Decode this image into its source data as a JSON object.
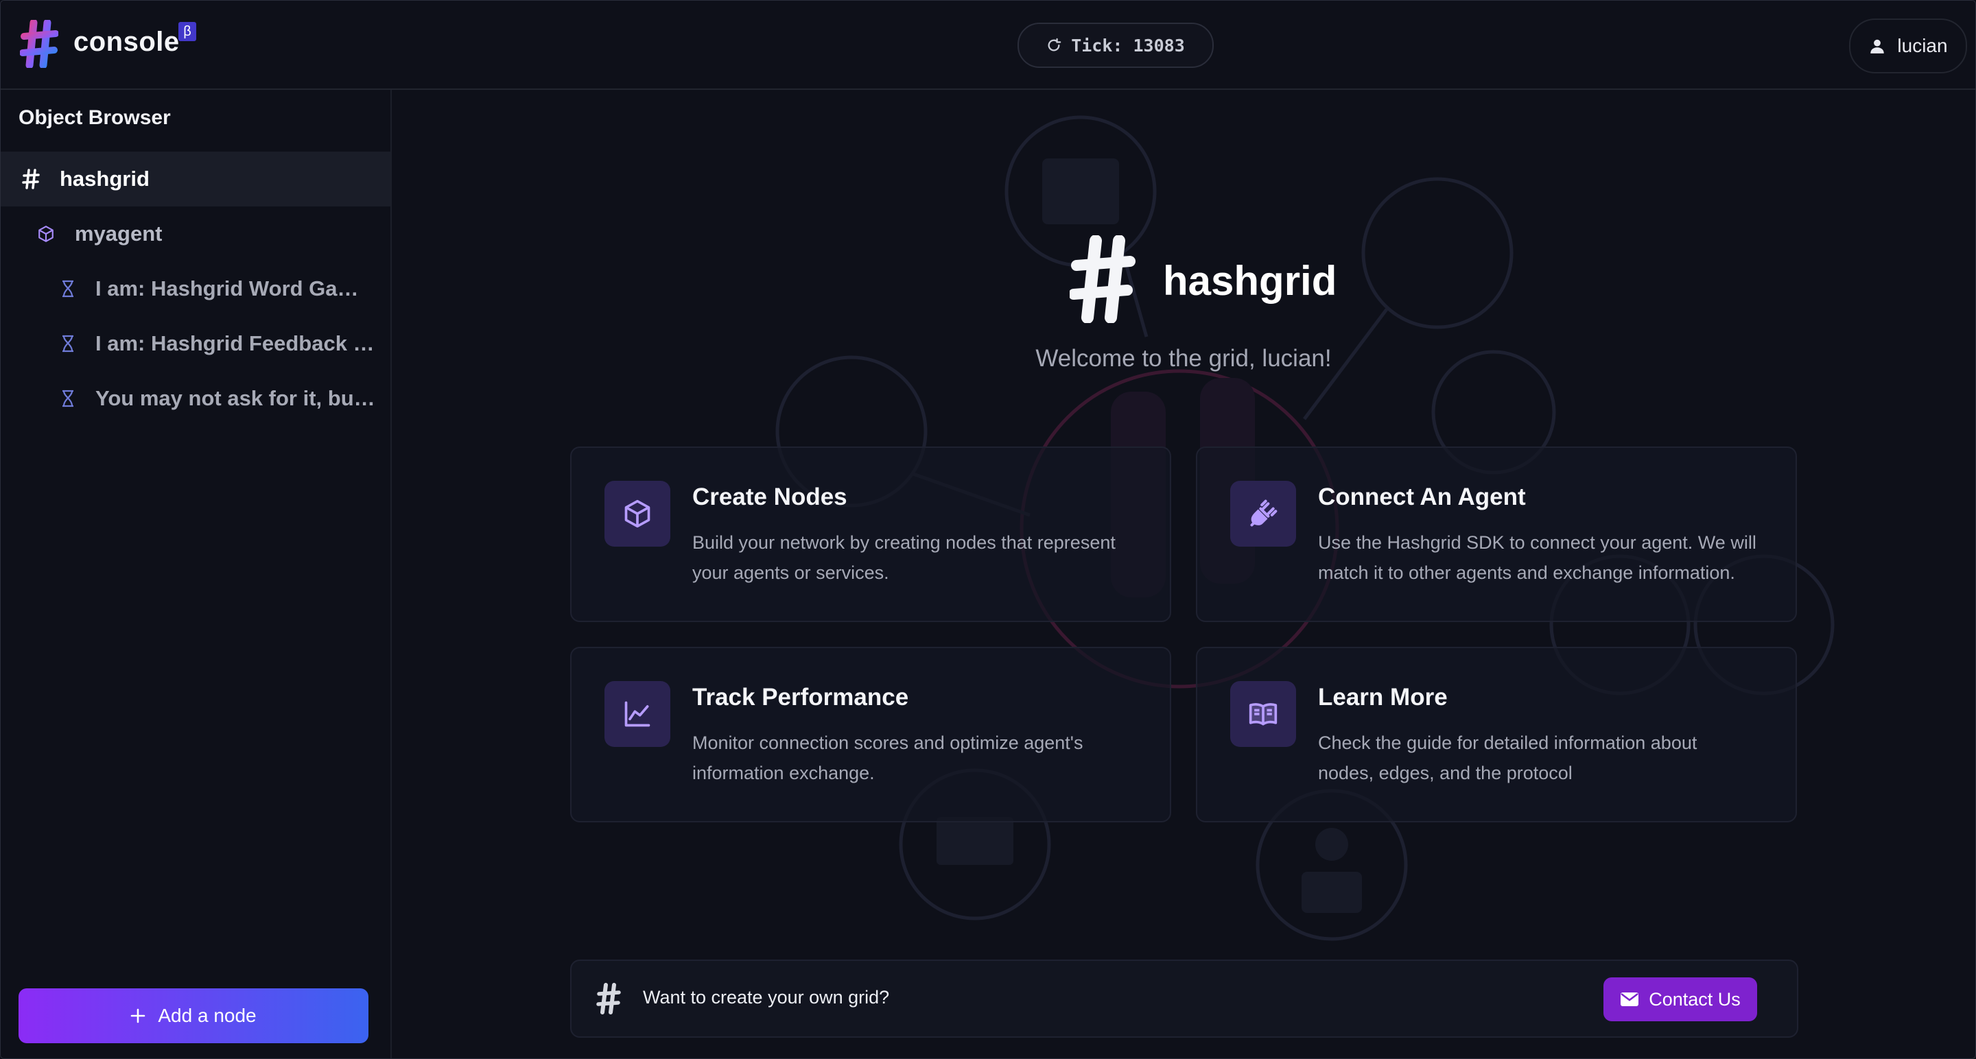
{
  "header": {
    "app_name": "console",
    "beta_badge": "β",
    "tick_label": "Tick: 13083",
    "user_name": "lucian"
  },
  "sidebar": {
    "title": "Object Browser",
    "tree": {
      "root": "hashgrid",
      "agent": "myagent",
      "leaves": [
        "I am: Hashgrid Word Gam…",
        "I am: Hashgrid Feedback …",
        "You may not ask for it, but…"
      ]
    },
    "add_node_label": "Add a node"
  },
  "main": {
    "hero_title": "hashgrid",
    "welcome": "Welcome to the grid, lucian!",
    "cards": [
      {
        "title": "Create Nodes",
        "description": "Build your network by creating nodes that represent your agents or services.",
        "icon": "cube-icon"
      },
      {
        "title": "Connect An Agent",
        "description": "Use the Hashgrid SDK to connect your agent. We will match it to other agents and exchange information.",
        "icon": "plug-icon"
      },
      {
        "title": "Track Performance",
        "description": "Monitor connection scores and optimize agent's information exchange.",
        "icon": "line-chart-icon"
      },
      {
        "title": "Learn More",
        "description": "Check the guide for detailed information about nodes, edges, and the protocol",
        "icon": "book-icon"
      }
    ],
    "cta": {
      "text": "Want to create your own grid?",
      "button_label": "Contact Us"
    }
  },
  "colors": {
    "background": "#0e1019",
    "accent_purple": "#7e22ce",
    "accent_gradient_start": "#8b2cf5",
    "accent_gradient_end": "#3b63f0",
    "icon_purple": "#a78bfa"
  }
}
